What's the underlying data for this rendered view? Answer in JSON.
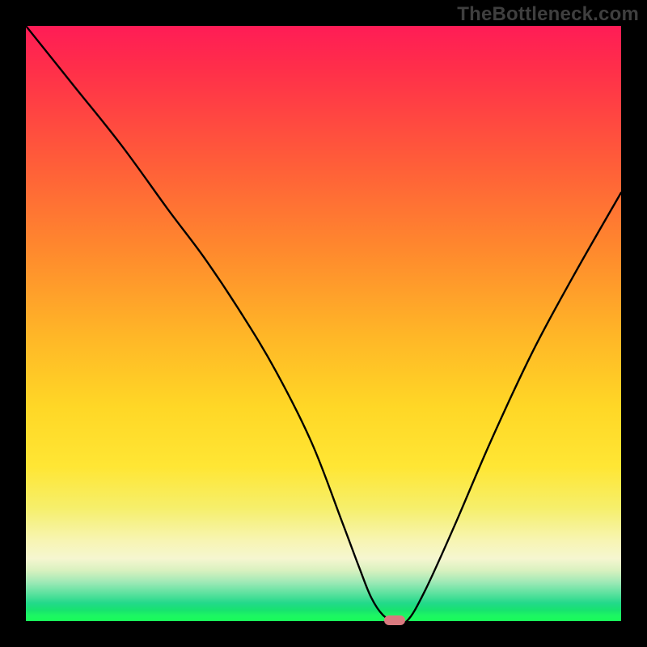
{
  "watermark": {
    "text": "TheBottleneck.com"
  },
  "colors": {
    "curve": "#000000",
    "marker": "#d97a7f",
    "frame": "#000000"
  },
  "chart_data": {
    "type": "line",
    "title": "",
    "xlabel": "",
    "ylabel": "",
    "xlim": [
      0,
      100
    ],
    "ylim": [
      0,
      100
    ],
    "grid": false,
    "legend": false,
    "annotations": [
      {
        "kind": "marker",
        "x": 62,
        "y": 0,
        "shape": "pill",
        "color": "#d97a7f"
      }
    ],
    "series": [
      {
        "name": "bottleneck-curve",
        "x": [
          0,
          8,
          16,
          24,
          30,
          36,
          42,
          48,
          53,
          56,
          58,
          60,
          62,
          64,
          67,
          72,
          78,
          85,
          92,
          100
        ],
        "y": [
          100,
          90,
          80,
          69,
          61,
          52,
          42,
          30,
          17,
          9,
          4,
          1,
          0,
          0,
          5,
          16,
          30,
          45,
          58,
          72
        ]
      }
    ],
    "background_gradient": {
      "orientation": "vertical",
      "stops": [
        {
          "pos": 0.0,
          "color": "#ff1c56"
        },
        {
          "pos": 0.22,
          "color": "#ff5a3a"
        },
        {
          "pos": 0.52,
          "color": "#ffb627"
        },
        {
          "pos": 0.74,
          "color": "#ffe634"
        },
        {
          "pos": 0.88,
          "color": "#f7f5b3"
        },
        {
          "pos": 0.94,
          "color": "#9de9b6"
        },
        {
          "pos": 0.98,
          "color": "#17e36e"
        },
        {
          "pos": 1.0,
          "color": "#18fc59"
        }
      ]
    }
  }
}
